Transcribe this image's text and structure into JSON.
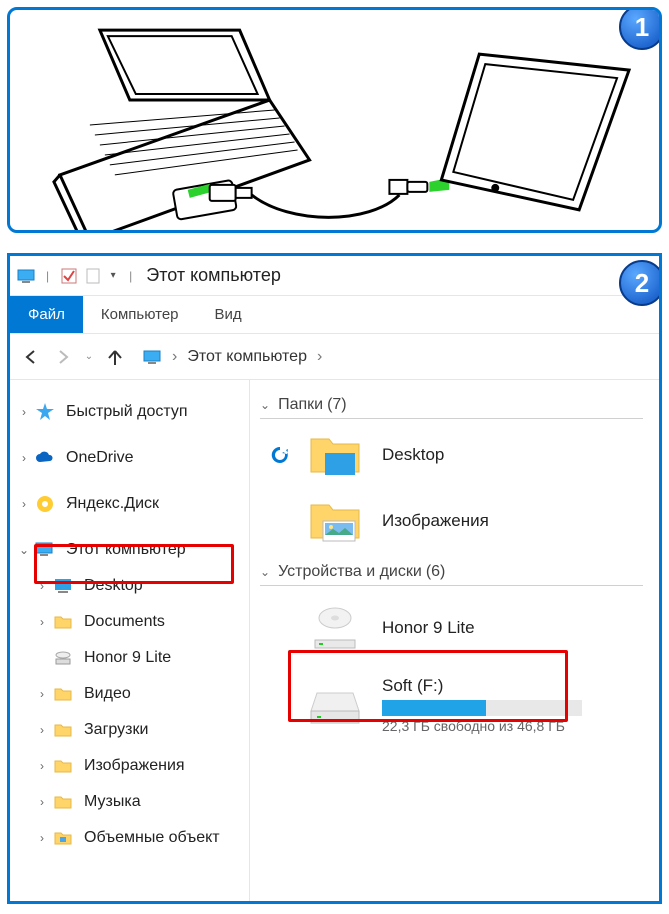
{
  "badges": {
    "one": "1",
    "two": "2"
  },
  "window": {
    "title": "Этот компьютер"
  },
  "tabs": {
    "file": "Файл",
    "computer": "Компьютер",
    "view": "Вид"
  },
  "breadcrumb": {
    "root": "Этот компьютер"
  },
  "sidebar": {
    "quick_access": "Быстрый доступ",
    "onedrive": "OneDrive",
    "yandex_disk": "Яндекс.Диск",
    "this_pc": "Этот компьютер",
    "children": {
      "desktop": "Desktop",
      "documents": "Documents",
      "honor": "Honor 9 Lite",
      "video": "Видео",
      "downloads": "Загрузки",
      "pictures": "Изображения",
      "music": "Музыка",
      "volumes": "Объемные объект"
    }
  },
  "groups": {
    "folders": {
      "label": "Папки",
      "count": "(7)"
    },
    "devices": {
      "label": "Устройства и диски",
      "count": "(6)"
    }
  },
  "items": {
    "desktop": "Desktop",
    "pictures": "Изображения",
    "honor": "Honor 9 Lite",
    "soft": {
      "label": "Soft (F:)",
      "free_text": "22,3 ГБ свободно из 46,8 ГБ",
      "used_pct": 52
    }
  }
}
